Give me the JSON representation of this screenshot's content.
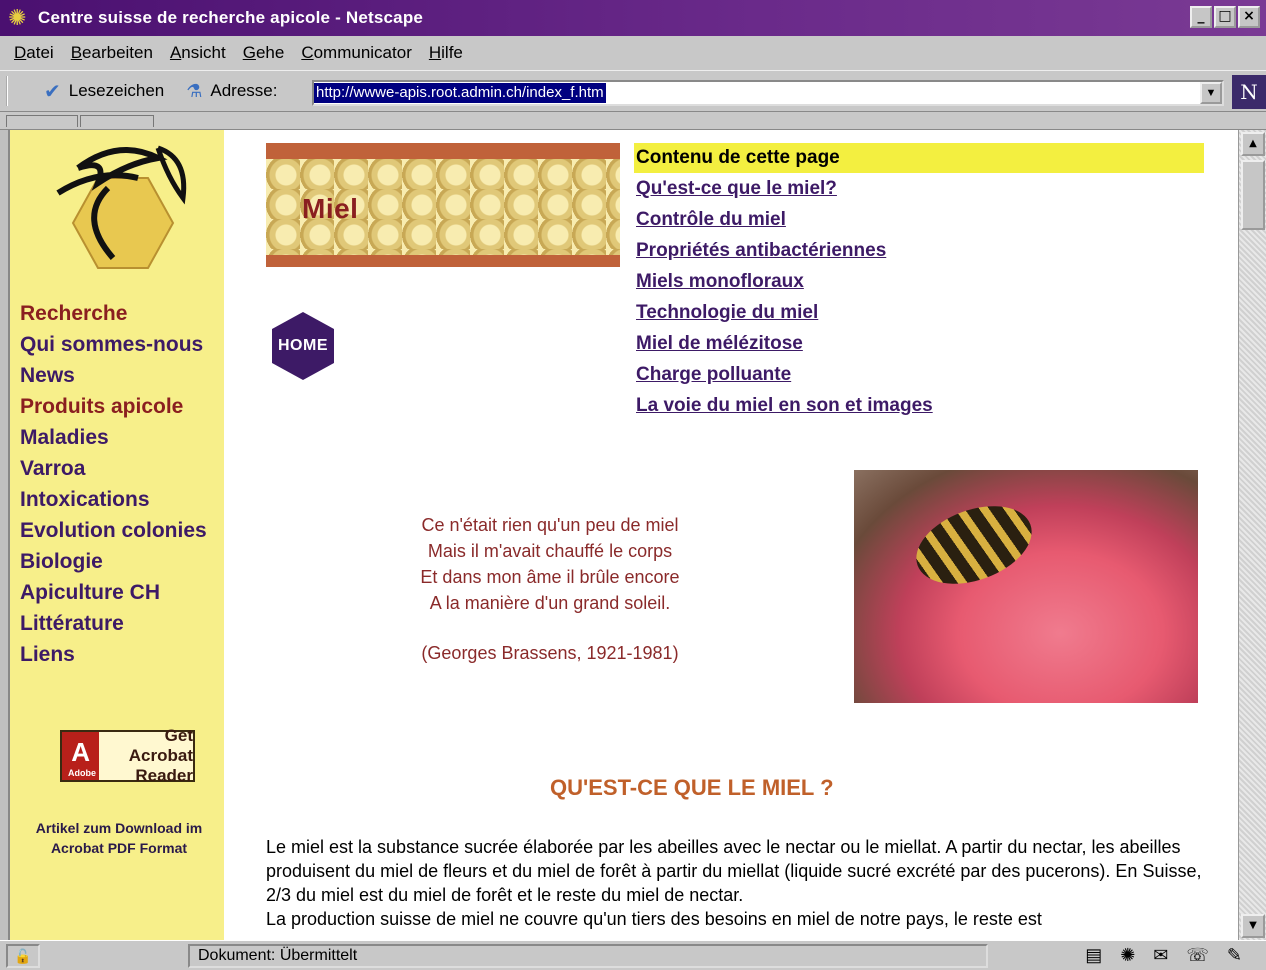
{
  "window": {
    "title": "Centre suisse de recherche apicole - Netscape",
    "icon": "netscape-star-icon",
    "buttons": [
      "_",
      "□",
      "×"
    ]
  },
  "menubar": {
    "items": [
      "Datei",
      "Bearbeiten",
      "Ansicht",
      "Gehe",
      "Communicator",
      "Hilfe"
    ]
  },
  "toolbar": {
    "bookmarks_label": "Lesezeichen",
    "address_label": "Adresse:",
    "url": "http://wwwe-apis.root.admin.ch/index_f.htm"
  },
  "sidebar": {
    "nav": [
      "Recherche",
      "Qui sommes-nous",
      "News",
      "Produits apicole",
      "Maladies",
      "Varroa",
      "Intoxications",
      "Evolution colonies",
      "Biologie",
      "Apiculture CH",
      "Littérature",
      "Liens"
    ],
    "acrobat": {
      "line1": "Get Acrobat",
      "line2": "Reader",
      "brand": "Adobe"
    },
    "acrobat_note": "Artikel zum Download im Acrobat PDF Format"
  },
  "content": {
    "banner_word": "Miel",
    "home_label": "HOME",
    "toc_header": "Contenu de cette page",
    "toc_links": [
      "Qu'est-ce que le miel?",
      "Contrôle du miel",
      "Propriétés antibactériennes",
      "Miels monofloraux",
      "Technologie du miel",
      "Miel de mélézitose",
      "Charge polluante",
      "La voie du miel en son et images"
    ],
    "poem": [
      "Ce n'était rien qu'un peu de miel",
      "Mais il m'avait chauffé le corps",
      "Et dans mon âme il brûle encore",
      "A la manière d'un grand soleil."
    ],
    "poem_author": "(Georges Brassens, 1921-1981)",
    "heading": "QU'EST-CE QUE  LE MIEL ?",
    "paragraph": "Le miel est la substance sucrée élaborée par les abeilles avec le nectar ou le miellat. A partir du nectar, les abeilles produisent du miel de fleurs et du miel de forêt à partir du miellat (liquide sucré excrété par des pucerons). En Suisse, 2/3 du miel est du miel de forêt et le reste du miel de nectar.",
    "paragraph2": "La production suisse de miel ne couvre qu'un tiers des besoins en miel de notre pays, le reste est"
  },
  "statusbar": {
    "text": "Dokument: Übermittelt"
  },
  "colors": {
    "sidebar_bg": "#f7ef8a",
    "nav_purple": "#3d1a66",
    "nav_red": "#8a1f20",
    "heading_orange": "#c0602a",
    "toc_highlight": "#f3ef40"
  }
}
